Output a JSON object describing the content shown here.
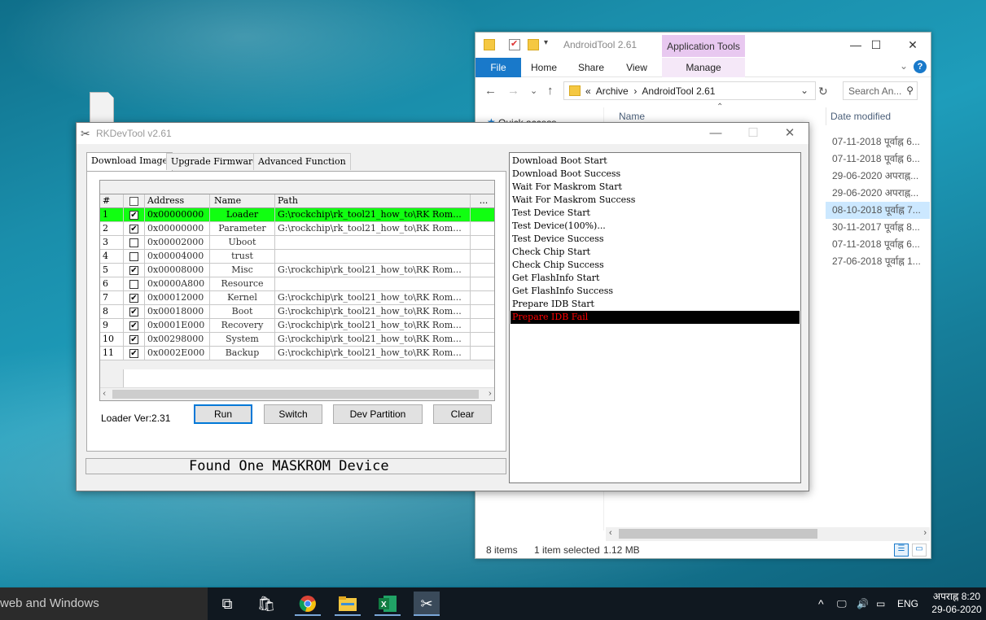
{
  "desktop": {
    "bg_color": "#1a8eab"
  },
  "explorer": {
    "title": "AndroidTool 2.61",
    "app_tools": "Application Tools",
    "ribbon": {
      "file": "File",
      "home": "Home",
      "share": "Share",
      "view": "View",
      "manage": "Manage"
    },
    "window_buttons": {
      "minimize": "—",
      "maximize": "☐",
      "close": "✕"
    },
    "address": {
      "prefix": "«",
      "crumb1": "Archive",
      "sep": "›",
      "crumb2": "AndroidTool 2.61"
    },
    "search_placeholder": "Search An...",
    "quick_access": "Quick access",
    "columns": {
      "name": "Name",
      "date": "Date modified"
    },
    "dates": [
      "07-11-2018 पूर्वाह्न 6...",
      "07-11-2018 पूर्वाह्न 6...",
      "29-06-2020 अपराह्न...",
      "29-06-2020 अपराह्न...",
      "08-10-2018 पूर्वाह्न 7...",
      "30-11-2017 पूर्वाह्न 8...",
      "07-11-2018 पूर्वाह्न 6...",
      "27-06-2018 पूर्वाह्न 1..."
    ],
    "selected_index": 4,
    "status": {
      "items": "8 items",
      "selected": "1 item selected",
      "size": "1.12 MB"
    }
  },
  "rk": {
    "title": "RKDevTool v2.61",
    "window_buttons": {
      "minimize": "—",
      "maximize": "☐",
      "close": "✕"
    },
    "tabs": [
      "Download Image",
      "Upgrade Firmware",
      "Advanced Function"
    ],
    "headers": {
      "num": "#",
      "address": "Address",
      "name": "Name",
      "path": "Path",
      "more": "..."
    },
    "rows": [
      {
        "n": "1",
        "checked": true,
        "address": "0x00000000",
        "name": "Loader",
        "path": "G:\\rockchip\\rk_tool21_how_to\\RK Rom...",
        "highlight": true
      },
      {
        "n": "2",
        "checked": true,
        "address": "0x00000000",
        "name": "Parameter",
        "path": "G:\\rockchip\\rk_tool21_how_to\\RK Rom..."
      },
      {
        "n": "3",
        "checked": false,
        "address": "0x00002000",
        "name": "Uboot",
        "path": ""
      },
      {
        "n": "4",
        "checked": false,
        "address": "0x00004000",
        "name": "trust",
        "path": ""
      },
      {
        "n": "5",
        "checked": true,
        "address": "0x00008000",
        "name": "Misc",
        "path": "G:\\rockchip\\rk_tool21_how_to\\RK Rom..."
      },
      {
        "n": "6",
        "checked": false,
        "address": "0x0000A800",
        "name": "Resource",
        "path": ""
      },
      {
        "n": "7",
        "checked": true,
        "address": "0x00012000",
        "name": "Kernel",
        "path": "G:\\rockchip\\rk_tool21_how_to\\RK Rom..."
      },
      {
        "n": "8",
        "checked": true,
        "address": "0x00018000",
        "name": "Boot",
        "path": "G:\\rockchip\\rk_tool21_how_to\\RK Rom..."
      },
      {
        "n": "9",
        "checked": true,
        "address": "0x0001E000",
        "name": "Recovery",
        "path": "G:\\rockchip\\rk_tool21_how_to\\RK Rom..."
      },
      {
        "n": "10",
        "checked": true,
        "address": "0x00298000",
        "name": "System",
        "path": "G:\\rockchip\\rk_tool21_how_to\\RK Rom..."
      },
      {
        "n": "11",
        "checked": true,
        "address": "0x0002E000",
        "name": "Backup",
        "path": "G:\\rockchip\\rk_tool21_how_to\\RK Rom..."
      }
    ],
    "loader_ver": "Loader Ver:2.31",
    "buttons": {
      "run": "Run",
      "switch": "Switch",
      "dev_partition": "Dev Partition",
      "clear": "Clear"
    },
    "status": "Found One MASKROM Device",
    "log": [
      "Download Boot Start",
      "Download Boot Success",
      "Wait For Maskrom Start",
      "Wait For Maskrom Success",
      "Test Device Start",
      "Test Device(100%)...",
      "Test Device Success",
      "Check Chip Start",
      " Check Chip Success",
      "Get FlashInfo Start",
      "Get FlashInfo Success",
      "Prepare IDB Start",
      "Prepare IDB Fail"
    ],
    "highlight_color": "#11ff11",
    "fail_color": "#ff0000"
  },
  "taskbar": {
    "search_text": "web and Windows",
    "icons": [
      "task-view-icon",
      "store-icon",
      "chrome-icon",
      "file-explorer-icon",
      "excel-icon",
      "rkdevtool-icon"
    ],
    "lang": "ENG",
    "time": "अपराह्न 8:20",
    "date": "29-06-2020"
  }
}
